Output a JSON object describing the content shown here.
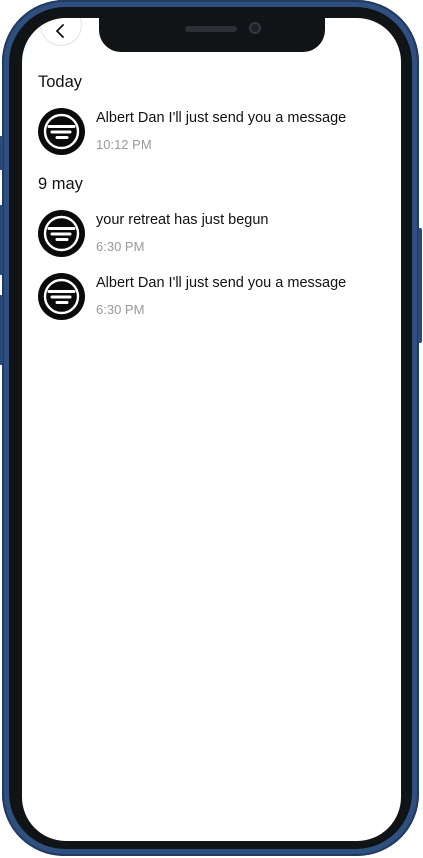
{
  "colors": {
    "frame": "#2f4f7f",
    "bezel": "#111417",
    "screen": "#ffffff",
    "text": "#111111",
    "muted": "#9a9a9a"
  },
  "header": {
    "back_icon": "chevron-left-icon"
  },
  "sections": [
    {
      "title": "Today",
      "items": [
        {
          "text": "Albert Dan I'll just send you a message",
          "time": "10:12 PM",
          "icon": "brand-logo-icon"
        }
      ]
    },
    {
      "title": "9 may",
      "items": [
        {
          "text": "your retreat has just begun",
          "time": "6:30 PM",
          "icon": "brand-logo-icon"
        },
        {
          "text": "Albert Dan I'll just send you a message",
          "time": "6:30 PM",
          "icon": "brand-logo-icon"
        }
      ]
    }
  ]
}
